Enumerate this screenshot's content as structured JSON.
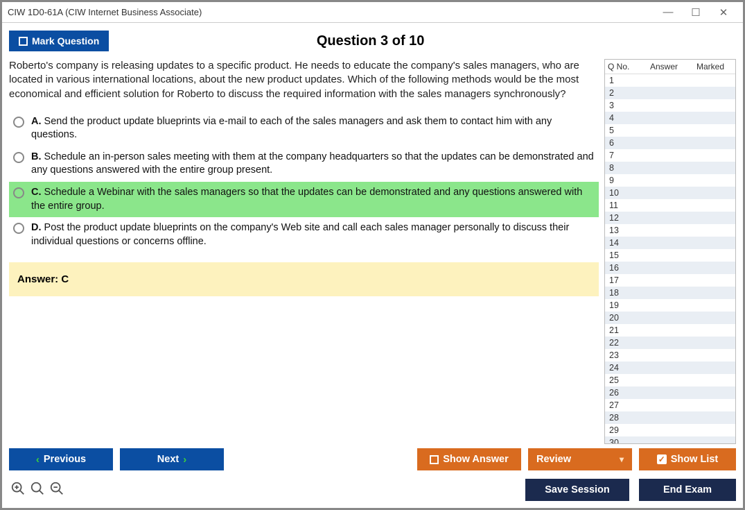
{
  "window": {
    "title": "CIW 1D0-61A (CIW Internet Business Associate)"
  },
  "topbar": {
    "mark_label": "Mark Question",
    "question_header": "Question 3 of 10"
  },
  "question": {
    "stem": "Roberto's company is releasing updates to a specific product. He needs to educate the company's sales managers, who are located in various international locations, about the new product updates. Which of the following methods would be the most economical and efficient solution for Roberto to discuss the required information with the sales managers synchronously?",
    "choices": [
      {
        "label": "A.",
        "text": "Send the product update blueprints via e-mail to each of the sales managers and ask them to contact him with any questions.",
        "correct": false
      },
      {
        "label": "B.",
        "text": "Schedule an in-person sales meeting with them at the company headquarters so that the updates can be demonstrated and any questions answered with the entire group present.",
        "correct": false
      },
      {
        "label": "C.",
        "text": "Schedule a Webinar with the sales managers so that the updates can be demonstrated and any questions answered with the entire group.",
        "correct": true
      },
      {
        "label": "D.",
        "text": "Post the product update blueprints on the company's Web site and call each sales manager personally to discuss their individual questions or concerns offline.",
        "correct": false
      }
    ],
    "answer_label": "Answer: C"
  },
  "list": {
    "hdr_qno": "Q No.",
    "hdr_answer": "Answer",
    "hdr_marked": "Marked",
    "rows": [
      1,
      2,
      3,
      4,
      5,
      6,
      7,
      8,
      9,
      10,
      11,
      12,
      13,
      14,
      15,
      16,
      17,
      18,
      19,
      20,
      21,
      22,
      23,
      24,
      25,
      26,
      27,
      28,
      29,
      30
    ]
  },
  "buttons": {
    "previous": "Previous",
    "next": "Next",
    "show_answer": "Show Answer",
    "review": "Review",
    "show_list": "Show List",
    "save_session": "Save Session",
    "end_exam": "End Exam"
  }
}
